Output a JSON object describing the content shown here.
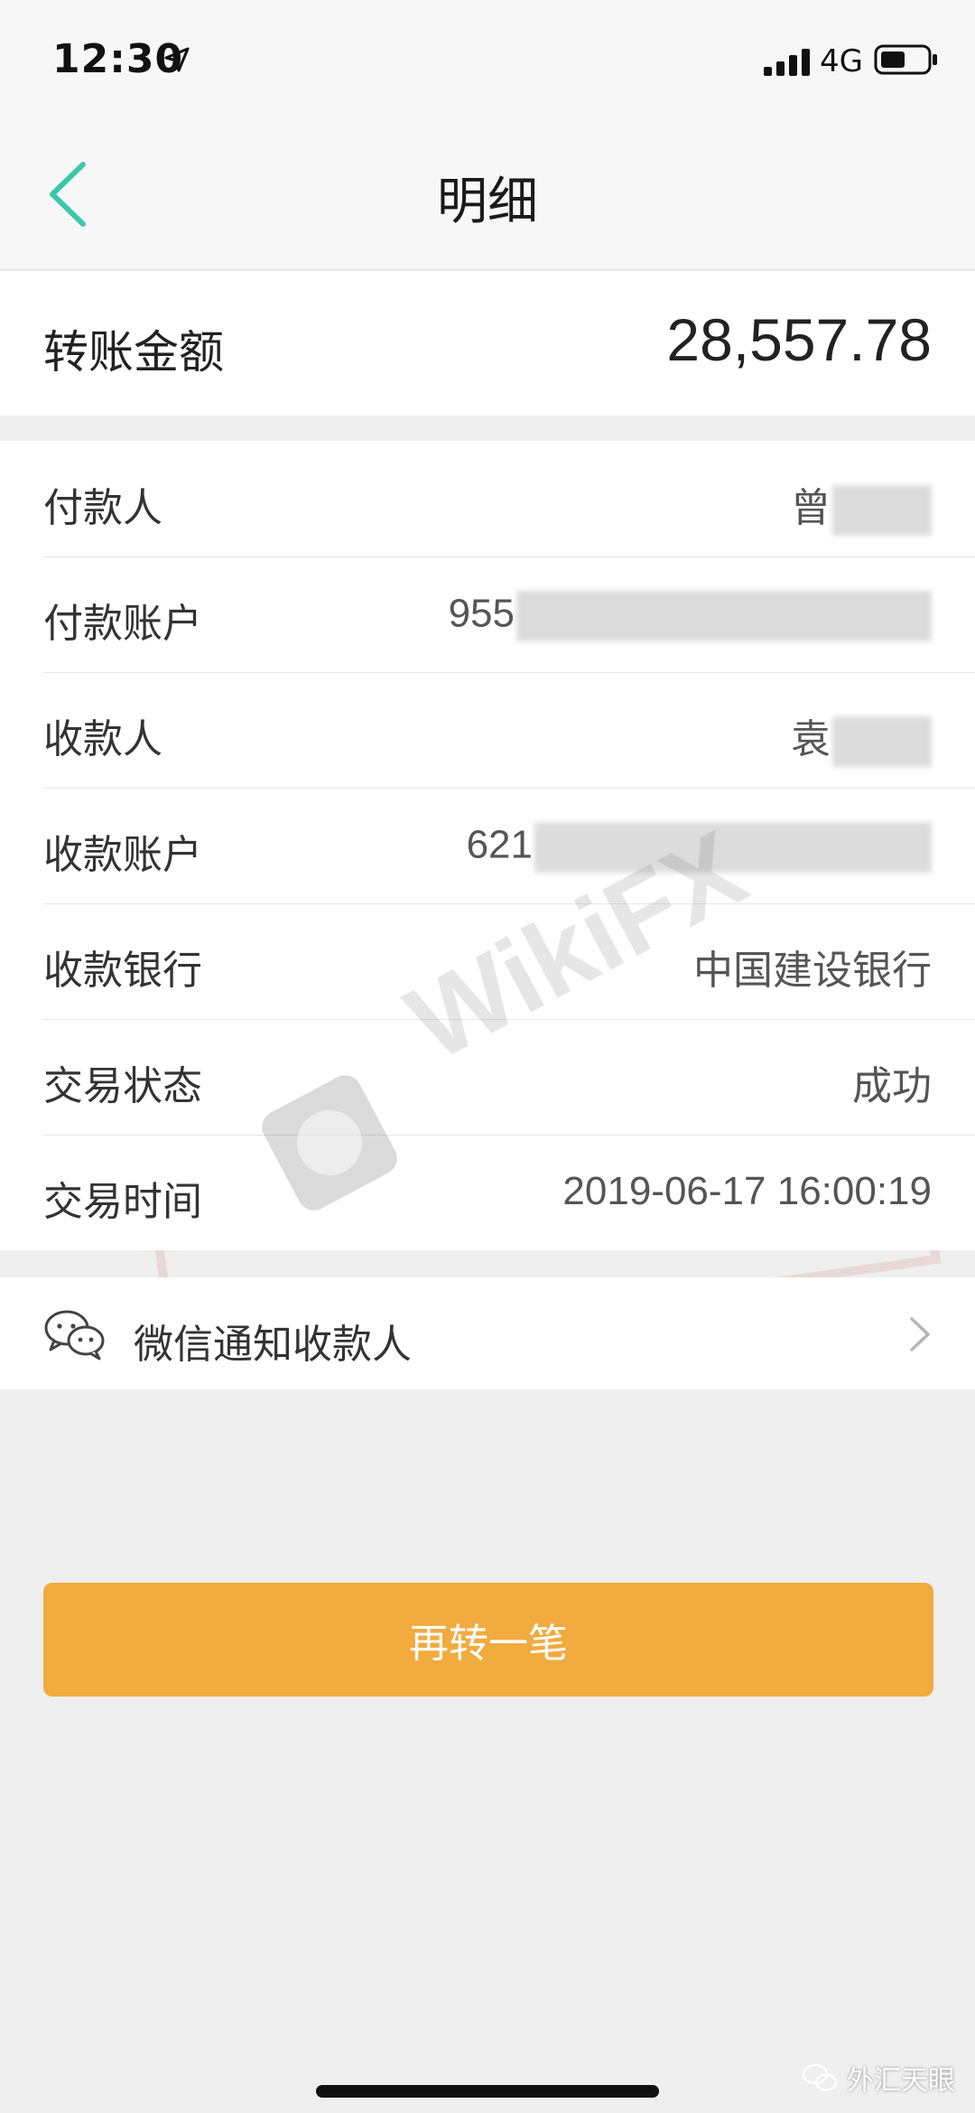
{
  "status_bar": {
    "time": "12:30",
    "network": "4G"
  },
  "nav": {
    "title": "明细"
  },
  "amount": {
    "label": "转账金额",
    "value": "28,557.78"
  },
  "details": [
    {
      "label": "付款人",
      "value": "曾"
    },
    {
      "label": "付款账户",
      "value": "955"
    },
    {
      "label": "收款人",
      "value": "袁"
    },
    {
      "label": "收款账户",
      "value": "621"
    },
    {
      "label": "收款银行",
      "value": "中国建设银行"
    },
    {
      "label": "交易状态",
      "value": "成功"
    },
    {
      "label": "交易时间",
      "value": "2019-06-17 16:00:19"
    }
  ],
  "notify": {
    "label": "微信通知收款人"
  },
  "action": {
    "label": "再转一笔"
  },
  "watermark": {
    "text": "WikiFX"
  },
  "source": {
    "label": "外汇天眼"
  },
  "colors": {
    "accent_back": "#3cc7a8",
    "button": "#f1ab3e",
    "page_background": "#efefef"
  },
  "icons": [
    "location-arrow-icon",
    "signal-icon",
    "battery-icon",
    "back-icon",
    "wechat-icon",
    "chevron-right-icon"
  ]
}
